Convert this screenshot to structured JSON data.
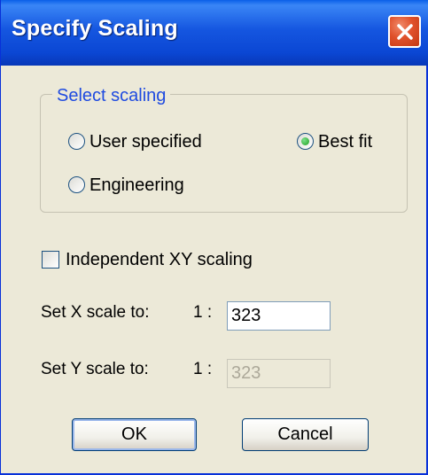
{
  "window": {
    "title": "Specify Scaling"
  },
  "group": {
    "label": "Select scaling",
    "options": [
      {
        "label": "User specified",
        "checked": false
      },
      {
        "label": "Best fit",
        "checked": true
      },
      {
        "label": "Engineering",
        "checked": false
      }
    ]
  },
  "independent_xy": {
    "label": "Independent XY scaling",
    "checked": false
  },
  "x_scale": {
    "label": "Set X scale to:",
    "ratio": "1 :",
    "value": "323"
  },
  "y_scale": {
    "label": "Set Y scale to:",
    "ratio": "1 :",
    "value": "323",
    "disabled": true
  },
  "buttons": {
    "ok": "OK",
    "cancel": "Cancel"
  },
  "colors": {
    "titlebar": "#0b47d4",
    "group_label": "#1f4be0",
    "dialog_bg": "#ece9d8",
    "close": "#e0512b"
  },
  "icons": {
    "close": "close-x-icon"
  }
}
